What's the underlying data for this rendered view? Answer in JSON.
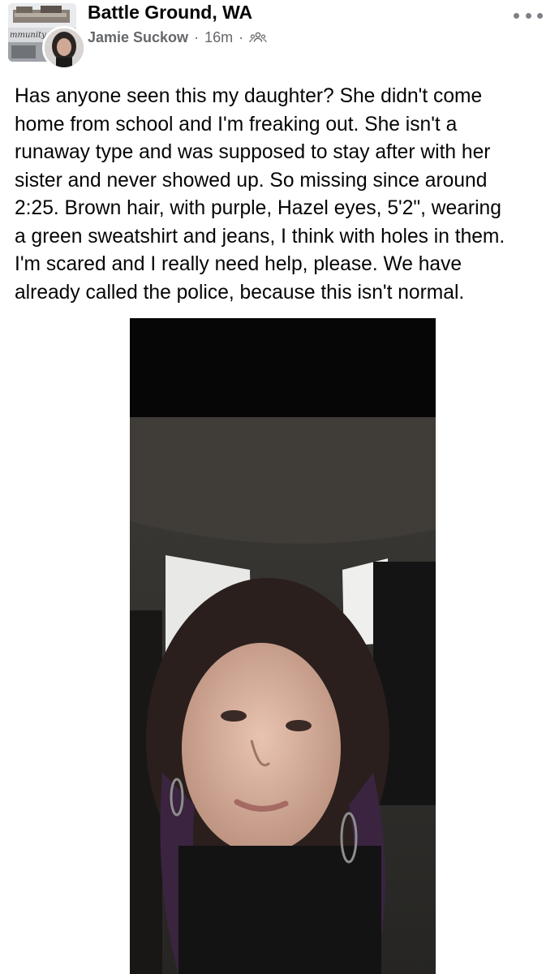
{
  "post": {
    "group_name": "Battle Ground, WA",
    "group_thumb_label": "mmunity P",
    "author_name": "Jamie Suckow",
    "timestamp": "16m",
    "meta_separator": "·",
    "audience_icon": "group-members-icon",
    "more_icon": "more-options-icon",
    "text": "Has anyone seen this my daughter?  She didn't come\nhome from school and I'm freaking out.  She isn't a\nrunaway type and was supposed to stay after with her\nsister and never showed up.  So missing since around\n2:25.  Brown hair, with purple, Hazel eyes, 5'2\", wearing\na green sweatshirt and jeans, I think with holes in them.\nI'm scared and I really need help, please.  We have\nalready called the police, because this isn't normal.",
    "photo_icon": "selfie-photo"
  }
}
